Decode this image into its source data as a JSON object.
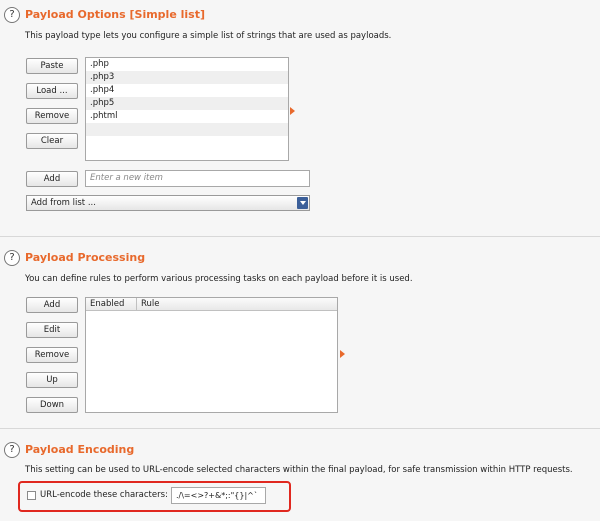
{
  "payload_options": {
    "help_icon": "?",
    "title": "Payload Options [Simple list]",
    "description": "This payload type lets you configure a simple list of strings that are used as payloads.",
    "buttons": {
      "paste": "Paste",
      "load": "Load ...",
      "remove": "Remove",
      "clear": "Clear",
      "add": "Add"
    },
    "items": [
      ".php",
      ".php3",
      ".php4",
      ".php5",
      ".phtml"
    ],
    "new_item_placeholder": "Enter a new item",
    "add_from_list": "Add from list ..."
  },
  "payload_processing": {
    "help_icon": "?",
    "title": "Payload Processing",
    "description": "You can define rules to perform various processing tasks on each payload before it is used.",
    "buttons": {
      "add": "Add",
      "edit": "Edit",
      "remove": "Remove",
      "up": "Up",
      "down": "Down"
    },
    "columns": [
      "Enabled",
      "Rule"
    ]
  },
  "payload_encoding": {
    "help_icon": "?",
    "title": "Payload Encoding",
    "description": "This setting can be used to URL-encode selected characters within the final payload, for safe transmission within HTTP requests.",
    "checkbox_label": "URL-encode these characters:",
    "checkbox_checked": false,
    "characters_value": "./\\=<>?+&*;:\"{}|^`"
  },
  "colors": {
    "accent": "#e8692c",
    "highlight": "#e0281f"
  }
}
